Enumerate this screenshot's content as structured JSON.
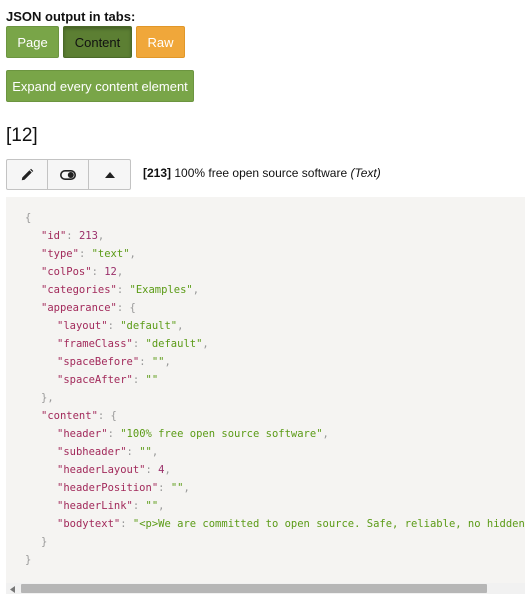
{
  "header": {
    "label": "JSON output in tabs:",
    "tabs": [
      {
        "label": "Page"
      },
      {
        "label": "Content"
      },
      {
        "label": "Raw"
      }
    ],
    "expand_label": "Expand every content element"
  },
  "colpos_heading": "[12]",
  "element": {
    "uid_label": "[213]",
    "title": "100% free open source software",
    "ctype_label": "(Text)",
    "toolbar_icons": [
      "pencil-icon",
      "toggle-icon",
      "caret-up-icon"
    ]
  },
  "code_lines": [
    {
      "indent": 0,
      "parts": [
        {
          "c": "p",
          "t": "{"
        }
      ]
    },
    {
      "indent": 1,
      "parts": [
        {
          "c": "k",
          "t": "\"id\""
        },
        {
          "c": "p",
          "t": ": "
        },
        {
          "c": "n",
          "t": "213"
        },
        {
          "c": "p",
          "t": ","
        }
      ]
    },
    {
      "indent": 1,
      "parts": [
        {
          "c": "k",
          "t": "\"type\""
        },
        {
          "c": "p",
          "t": ": "
        },
        {
          "c": "s",
          "t": "\"text\""
        },
        {
          "c": "p",
          "t": ","
        }
      ]
    },
    {
      "indent": 1,
      "parts": [
        {
          "c": "k",
          "t": "\"colPos\""
        },
        {
          "c": "p",
          "t": ": "
        },
        {
          "c": "n",
          "t": "12"
        },
        {
          "c": "p",
          "t": ","
        }
      ]
    },
    {
      "indent": 1,
      "parts": [
        {
          "c": "k",
          "t": "\"categories\""
        },
        {
          "c": "p",
          "t": ": "
        },
        {
          "c": "s",
          "t": "\"Examples\""
        },
        {
          "c": "p",
          "t": ","
        }
      ]
    },
    {
      "indent": 1,
      "parts": [
        {
          "c": "k",
          "t": "\"appearance\""
        },
        {
          "c": "p",
          "t": ": {"
        }
      ]
    },
    {
      "indent": 2,
      "parts": [
        {
          "c": "k",
          "t": "\"layout\""
        },
        {
          "c": "p",
          "t": ": "
        },
        {
          "c": "s",
          "t": "\"default\""
        },
        {
          "c": "p",
          "t": ","
        }
      ]
    },
    {
      "indent": 2,
      "parts": [
        {
          "c": "k",
          "t": "\"frameClass\""
        },
        {
          "c": "p",
          "t": ": "
        },
        {
          "c": "s",
          "t": "\"default\""
        },
        {
          "c": "p",
          "t": ","
        }
      ]
    },
    {
      "indent": 2,
      "parts": [
        {
          "c": "k",
          "t": "\"spaceBefore\""
        },
        {
          "c": "p",
          "t": ": "
        },
        {
          "c": "s",
          "t": "\"\""
        },
        {
          "c": "p",
          "t": ","
        }
      ]
    },
    {
      "indent": 2,
      "parts": [
        {
          "c": "k",
          "t": "\"spaceAfter\""
        },
        {
          "c": "p",
          "t": ": "
        },
        {
          "c": "s",
          "t": "\"\""
        }
      ]
    },
    {
      "indent": 1,
      "parts": [
        {
          "c": "p",
          "t": "},"
        }
      ]
    },
    {
      "indent": 1,
      "parts": [
        {
          "c": "k",
          "t": "\"content\""
        },
        {
          "c": "p",
          "t": ": {"
        }
      ]
    },
    {
      "indent": 2,
      "parts": [
        {
          "c": "k",
          "t": "\"header\""
        },
        {
          "c": "p",
          "t": ": "
        },
        {
          "c": "s",
          "t": "\"100% free open source software\""
        },
        {
          "c": "p",
          "t": ","
        }
      ]
    },
    {
      "indent": 2,
      "parts": [
        {
          "c": "k",
          "t": "\"subheader\""
        },
        {
          "c": "p",
          "t": ": "
        },
        {
          "c": "s",
          "t": "\"\""
        },
        {
          "c": "p",
          "t": ","
        }
      ]
    },
    {
      "indent": 2,
      "parts": [
        {
          "c": "k",
          "t": "\"headerLayout\""
        },
        {
          "c": "p",
          "t": ": "
        },
        {
          "c": "n",
          "t": "4"
        },
        {
          "c": "p",
          "t": ","
        }
      ]
    },
    {
      "indent": 2,
      "parts": [
        {
          "c": "k",
          "t": "\"headerPosition\""
        },
        {
          "c": "p",
          "t": ": "
        },
        {
          "c": "s",
          "t": "\"\""
        },
        {
          "c": "p",
          "t": ","
        }
      ]
    },
    {
      "indent": 2,
      "parts": [
        {
          "c": "k",
          "t": "\"headerLink\""
        },
        {
          "c": "p",
          "t": ": "
        },
        {
          "c": "s",
          "t": "\"\""
        },
        {
          "c": "p",
          "t": ","
        }
      ]
    },
    {
      "indent": 2,
      "parts": [
        {
          "c": "k",
          "t": "\"bodytext\""
        },
        {
          "c": "p",
          "t": ": "
        },
        {
          "c": "s",
          "t": "\"<p>We are committed to open source. Safe, reliable, no hidden ag"
        }
      ]
    },
    {
      "indent": 1,
      "parts": [
        {
          "c": "p",
          "t": "}"
        }
      ]
    },
    {
      "indent": 0,
      "parts": [
        {
          "c": "p",
          "t": "}"
        }
      ]
    }
  ],
  "colors": {
    "green": "#79a548",
    "dark_green": "#5c7f33",
    "orange": "#f0a73a",
    "code_bg": "#f5f4f2",
    "key": "#a22a5b",
    "string": "#5b9b16"
  }
}
